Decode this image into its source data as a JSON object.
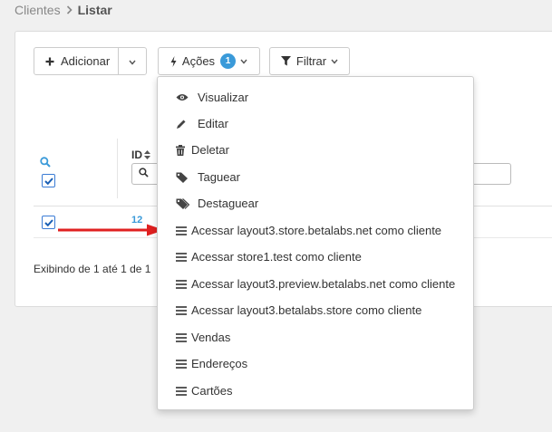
{
  "breadcrumb": {
    "parent": "Clientes",
    "separator_icon": "chevron-right-icon",
    "current": "Listar"
  },
  "toolbar": {
    "add_label": "Adicionar",
    "add_icon": "plus-icon",
    "add_caret_icon": "chevron-down-icon",
    "actions_label": "Ações",
    "actions_icon": "bolt-icon",
    "actions_count": "1",
    "filter_label": "Filtrar",
    "filter_icon": "funnel-icon"
  },
  "table": {
    "search_icon": "search-icon",
    "id_header": "ID",
    "sort_icon": "sort-icon",
    "rows": [
      {
        "id": "12",
        "checked": true
      }
    ],
    "footer": "Exibindo de 1 até 1 de 1"
  },
  "actions_menu": {
    "items": [
      {
        "label": "Visualizar",
        "icon": "eye-icon"
      },
      {
        "label": "Editar",
        "icon": "pencil-icon"
      },
      {
        "label": "Deletar",
        "icon": "trash-icon"
      },
      {
        "label": "Taguear",
        "icon": "tag-icon"
      },
      {
        "label": "Destaguear",
        "icon": "tags-icon"
      },
      {
        "label": "Acessar layout3.store.betalabs.net como cliente",
        "icon": "bars-icon"
      },
      {
        "label": "Acessar store1.test como cliente",
        "icon": "bars-icon"
      },
      {
        "label": "Acessar layout3.preview.betalabs.net como cliente",
        "icon": "bars-icon"
      },
      {
        "label": "Acessar layout3.betalabs.store como cliente",
        "icon": "bars-icon"
      },
      {
        "label": "Vendas",
        "icon": "bars-icon"
      },
      {
        "label": "Endereços",
        "icon": "bars-icon"
      },
      {
        "label": "Cartões",
        "icon": "bars-icon"
      }
    ]
  },
  "annotation": {
    "arrow_color": "#e02020"
  },
  "colors": {
    "accent": "#3a9ad9",
    "checkbox_border": "#3a7bd5"
  }
}
